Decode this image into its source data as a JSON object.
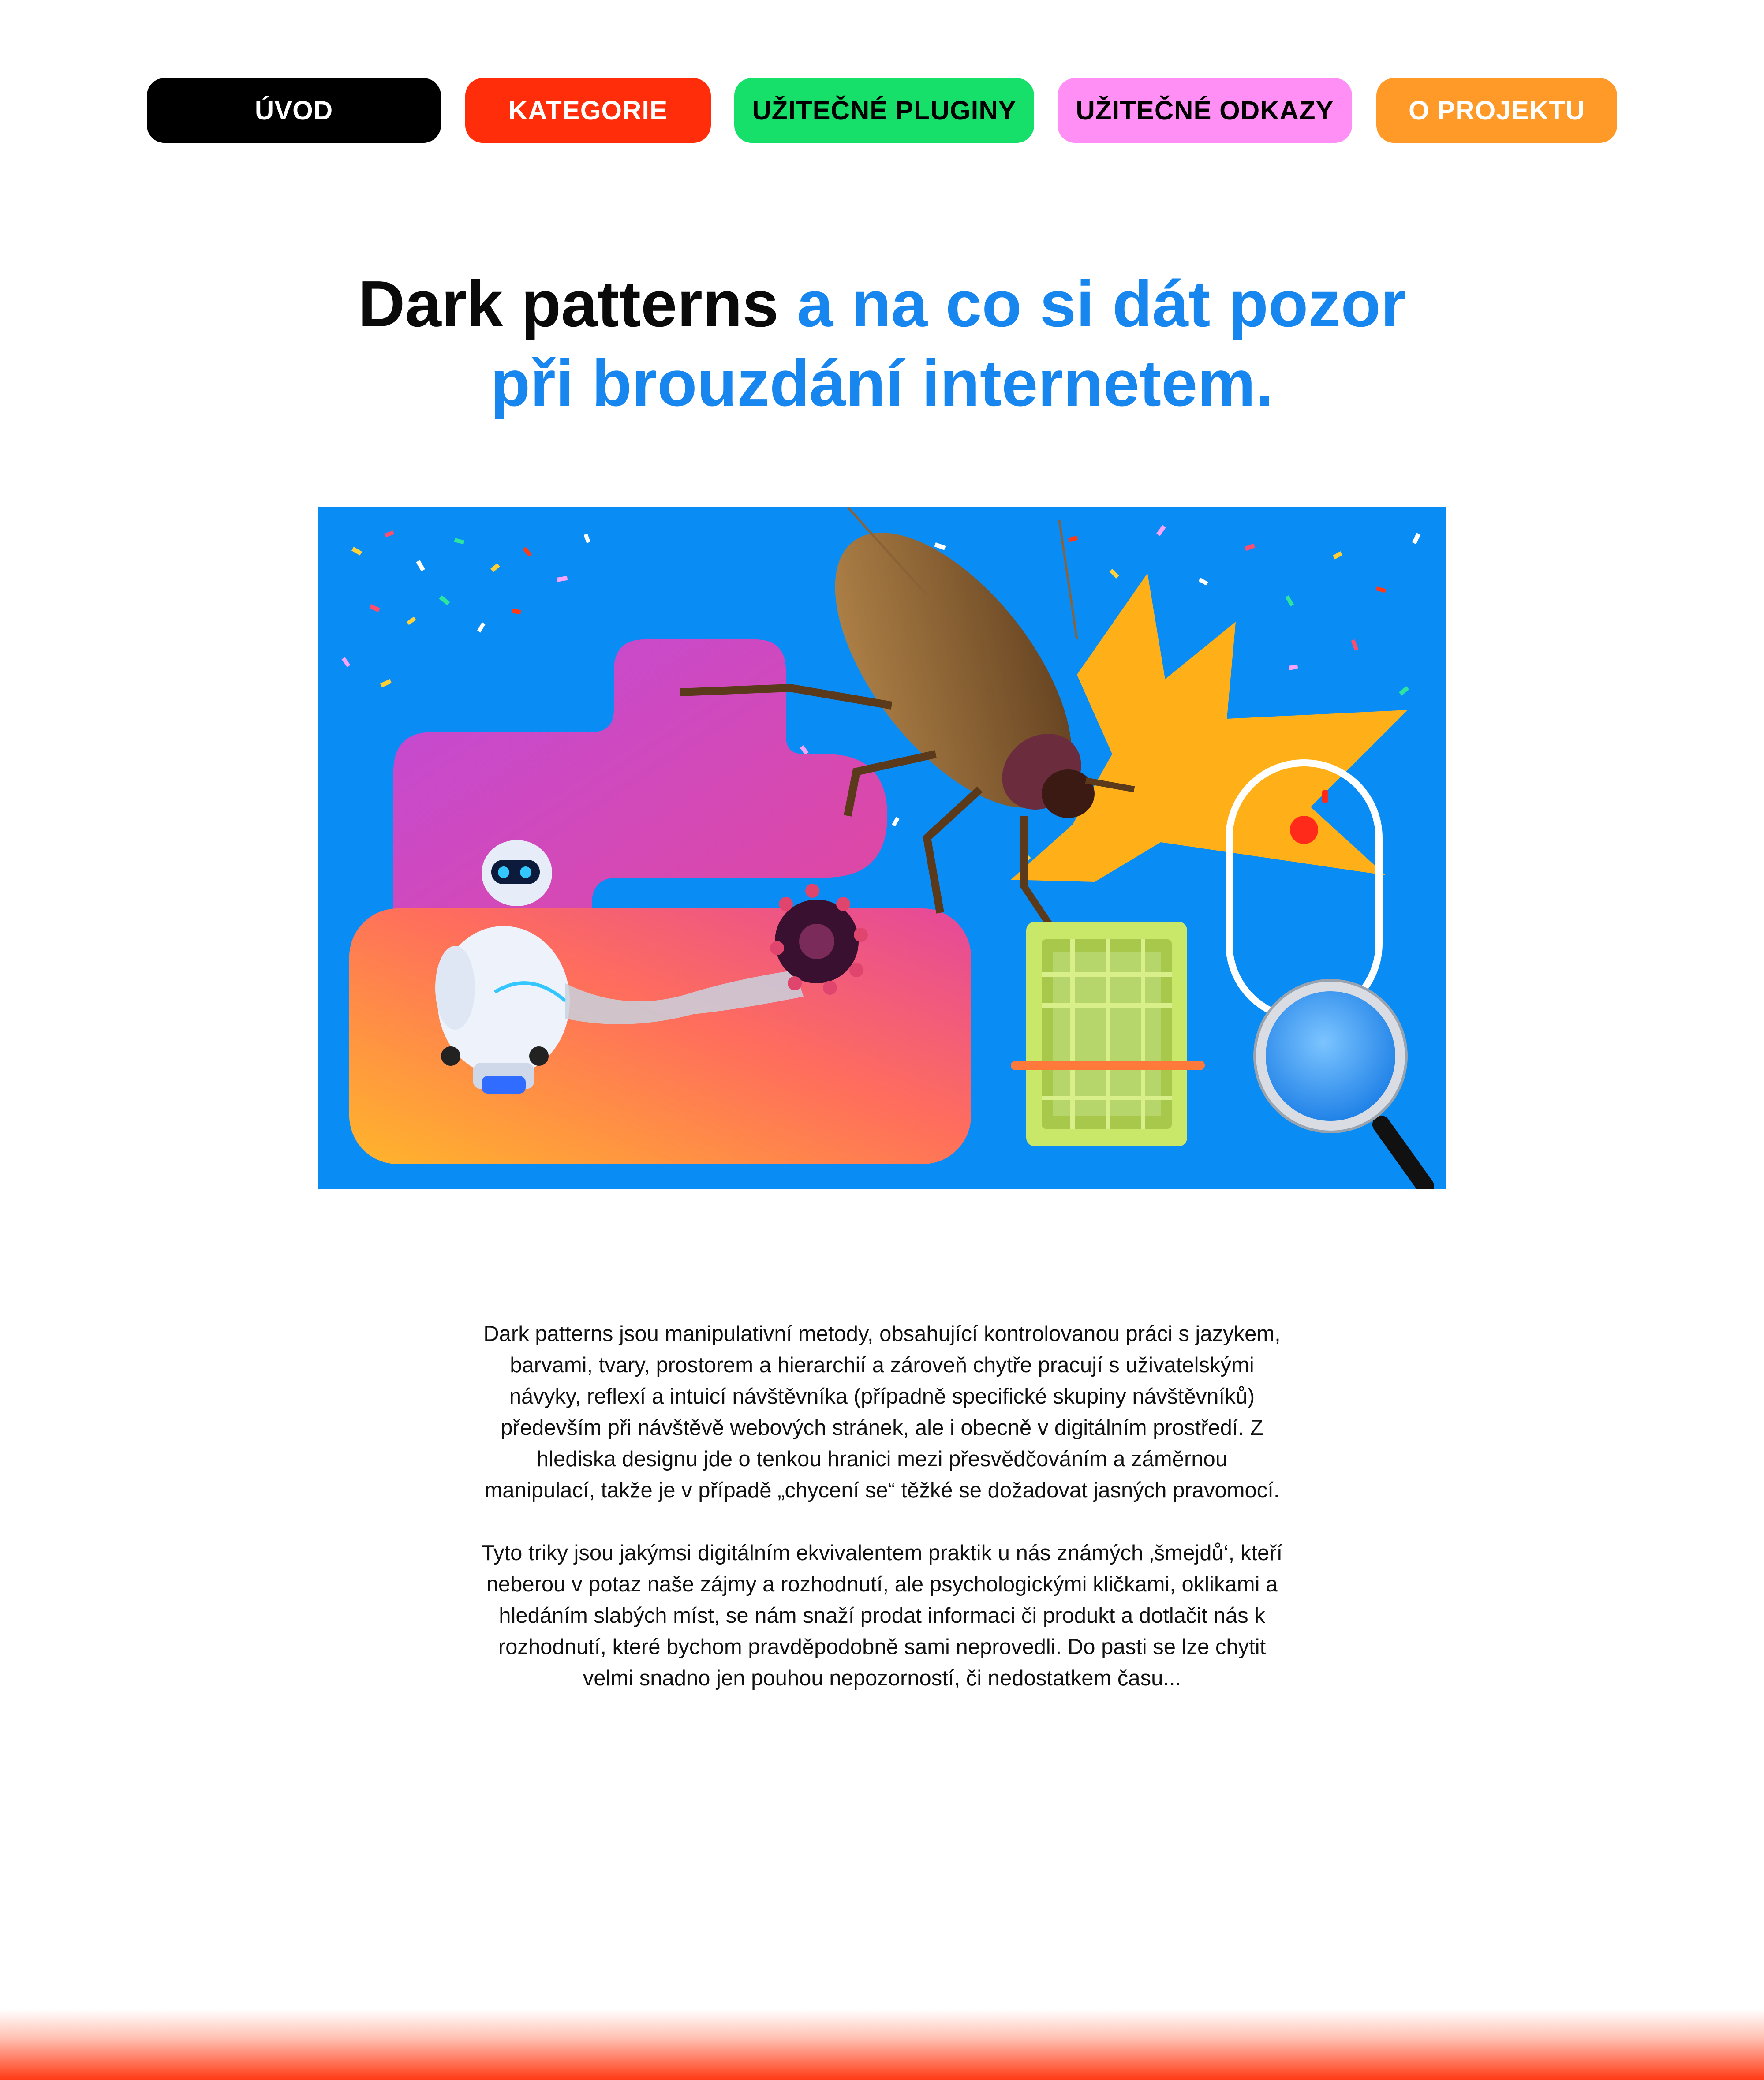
{
  "nav": {
    "items": [
      {
        "label": "ÚVOD",
        "color": "#000000"
      },
      {
        "label": "KATEGORIE",
        "color": "#ff2d0a"
      },
      {
        "label": "UŽITEČNÉ PLUGINY",
        "color": "#16e06a"
      },
      {
        "label": "UŽITEČNÉ ODKAZY",
        "color": "#ff8ff4"
      },
      {
        "label": "O PROJEKTU",
        "color": "#ff9928"
      }
    ]
  },
  "hero": {
    "title_dark": "Dark patterns",
    "title_blue_line1": " a na co si dát pozor",
    "title_blue_line2": "při brouzdání internetem.",
    "illustration_icons": [
      "robot-icon",
      "cockroach-icon",
      "shopping-basket-icon",
      "magnifier-icon",
      "mouse-icon",
      "confetti"
    ]
  },
  "content": {
    "paragraph1": "Dark patterns jsou manipulativní metody, obsahující kontrolovanou práci s jazykem, barvami, tvary, prostorem a hierarchií a zároveň chytře pracují s uživatelskými návyky, reflexí a intuicí návštěvníka (případně specifické skupiny návštěvníků) především při návštěvě webových stránek, ale i obecně v digitálním prostředí. Z hlediska designu jde o tenkou hranici mezi přesvědčováním a záměrnou manipulací, takže je v případě „chycení se“ těžké se dožadovat jasných pravomocí.",
    "paragraph2": "Tyto triky jsou jakýmsi digitálním ekvivalentem praktik u nás známých ‚šmejdů‘, kteří neberou v potaz naše zájmy a rozhodnutí, ale psychologickými kličkami, oklikami a hledáním slabých míst, se nám snaží prodat informaci či produkt a dotlačit nás k rozhodnutí, které bychom pravděpodobně sami neprovedli. Do pasti se lze chytit velmi snadno jen pouhou nepozorností, či nedostatkem času..."
  },
  "colors": {
    "accent_blue": "#1786ee",
    "hero_bg": "#0a8cf5",
    "footer_red": "#ff3a14"
  }
}
